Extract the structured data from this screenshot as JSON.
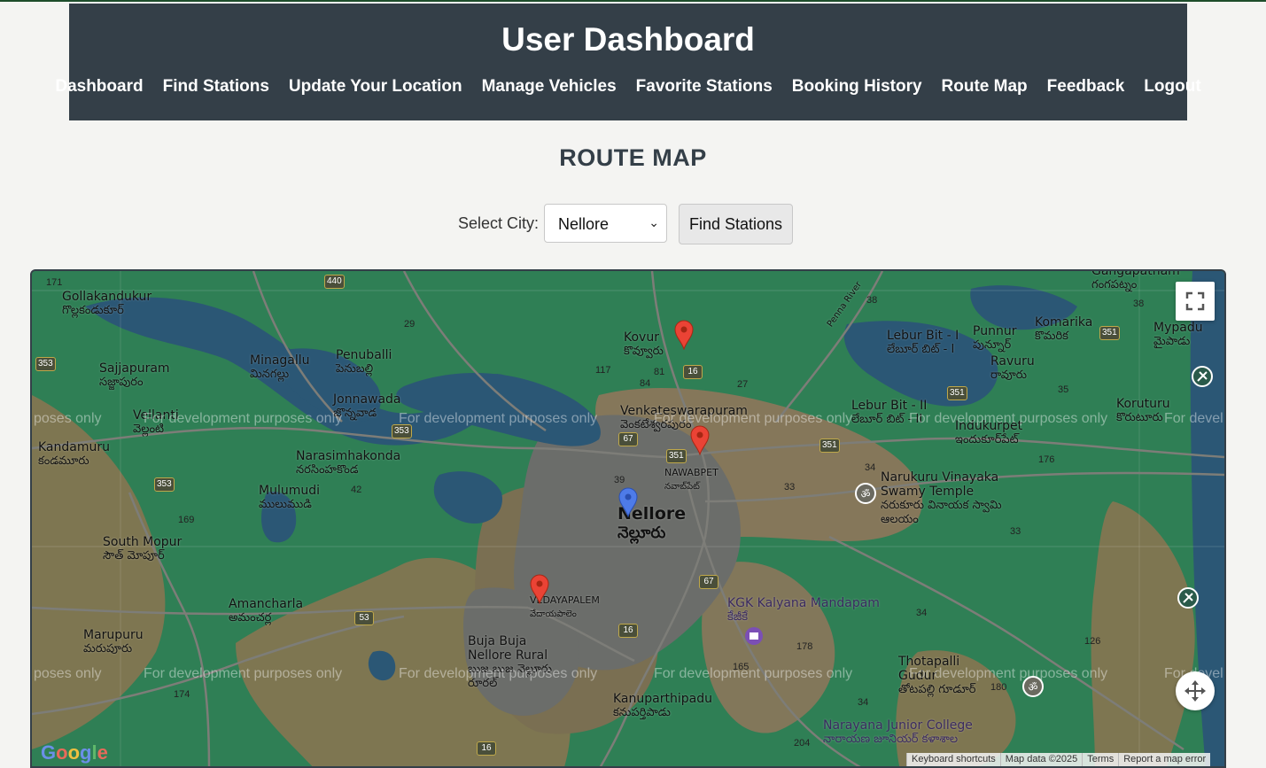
{
  "header": {
    "title": "User Dashboard",
    "nav": [
      "Dashboard",
      "Find Stations",
      "Update Your Location",
      "Manage Vehicles",
      "Favorite Stations",
      "Booking History",
      "Route Map",
      "Feedback",
      "Logout"
    ]
  },
  "page": {
    "heading": "ROUTE MAP"
  },
  "controls": {
    "city_label": "Select City:",
    "city_value": "Nellore",
    "find_button": "Find Stations"
  },
  "map": {
    "watermark": "For development purposes only",
    "watermark_edge_left": "poses only",
    "watermark_edge_right": "For devel",
    "places": [
      {
        "name": "Gollakandukur",
        "sub": "గొల్లకండుకూర్"
      },
      {
        "name": "Sajjapuram",
        "sub": "సజ్జాపురం"
      },
      {
        "name": "Minagallu",
        "sub": "మినగల్లు"
      },
      {
        "name": "Penuballi",
        "sub": "పెనుబల్లి"
      },
      {
        "name": "Jonnawada",
        "sub": "జొన్నవాడ"
      },
      {
        "name": "Vellanti",
        "sub": "వెల్లంటి"
      },
      {
        "name": "Kandamuru",
        "sub": "కండమూరు"
      },
      {
        "name": "Narasimhakonda",
        "sub": "నరసింహకొండ"
      },
      {
        "name": "Mulumudi",
        "sub": "ములుముడి"
      },
      {
        "name": "South Mopur",
        "sub": "సౌత్ మోపూర్"
      },
      {
        "name": "Amancharla",
        "sub": "అమంచర్ల"
      },
      {
        "name": "Marupuru",
        "sub": "మరుపూరు"
      },
      {
        "name": "Kovur",
        "sub": "కొవ్వూరు"
      },
      {
        "name": "Venkateswarapuram",
        "sub": "వెంకటేశ్వరపురం"
      },
      {
        "name": "NAWABPET",
        "sub": "నవాబ్‌పేట్"
      },
      {
        "name": "Nellore",
        "sub": "నెల్లూరు"
      },
      {
        "name": "VEDAYAPALEM",
        "sub": "వేదాయపాలెం"
      },
      {
        "name": "Buja Buja Nellore Rural",
        "sub": "బుజ బుజ నెల్లూరు రూరల్"
      },
      {
        "name": "Kanuparthipadu",
        "sub": "కనుపర్తిపాడు"
      },
      {
        "name": "Lebur Bit - I",
        "sub": "లేబూర్ బిట్ - I"
      },
      {
        "name": "Lebur Bit - II",
        "sub": "లేబూర్ బిట్ - II"
      },
      {
        "name": "Punnur",
        "sub": "పున్నూర్"
      },
      {
        "name": "Komarika",
        "sub": "కొమరిక"
      },
      {
        "name": "Ravuru",
        "sub": "రావూరు"
      },
      {
        "name": "Mypadu",
        "sub": "మైపాడు"
      },
      {
        "name": "Koruturu",
        "sub": "కొరుటూరు"
      },
      {
        "name": "Indukurpet",
        "sub": "ఇందుకూర్‌పేట్"
      },
      {
        "name": "Narukuru Vinayaka Swamy Temple",
        "sub": "నరుకూరు వినాయక స్వామి ఆలయం"
      },
      {
        "name": "KGK Kalyana Mandapam",
        "sub": "కేజీకే"
      },
      {
        "name": "Thotapalli Gudur",
        "sub": "తోటపల్లి గూడూర్"
      },
      {
        "name": "Narayana Junior College",
        "sub": "నారాయణ జూనియర్ కళాశాల"
      },
      {
        "name": "Gangapatnam",
        "sub": "గంగపట్నం"
      },
      {
        "name": "Penna River",
        "sub": ""
      }
    ],
    "road_numbers": [
      "171",
      "440",
      "29",
      "353",
      "117",
      "81",
      "84",
      "16",
      "27",
      "67",
      "351",
      "39",
      "42",
      "353",
      "169",
      "53",
      "67",
      "16",
      "165",
      "178",
      "34",
      "176",
      "33",
      "38",
      "38",
      "351",
      "351",
      "35",
      "126",
      "180",
      "174",
      "204",
      "16"
    ],
    "markers": {
      "station_color": "#ea4335",
      "user_color": "#4e7be8"
    },
    "attribution": [
      "Keyboard shortcuts",
      "Map data ©2025",
      "Terms",
      "Report a map error"
    ],
    "logo": "Google"
  }
}
